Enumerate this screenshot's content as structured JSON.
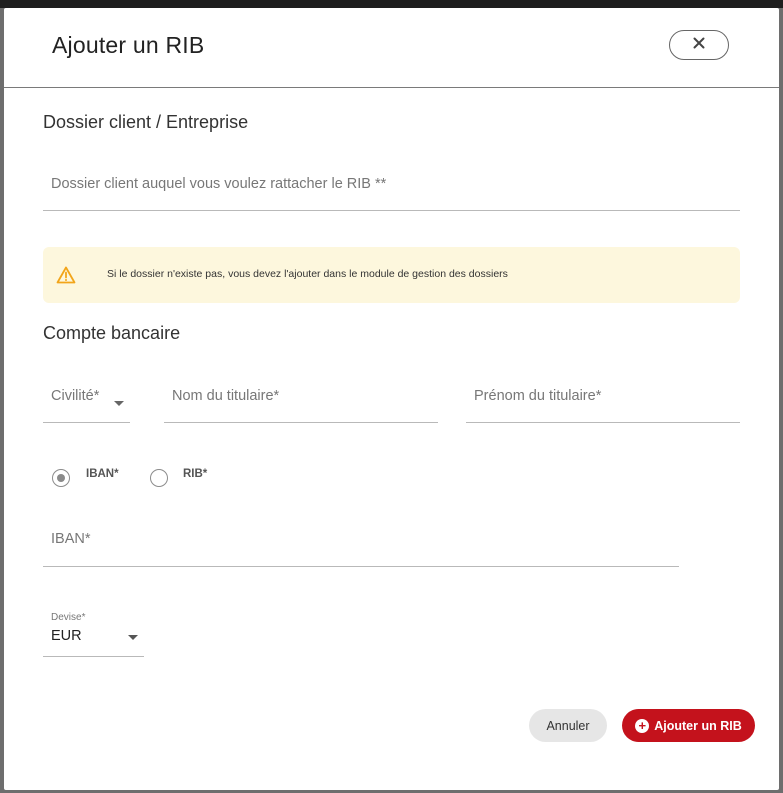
{
  "dialog": {
    "title": "Ajouter un RIB",
    "close_icon": "close-icon"
  },
  "dossier": {
    "section_title": "Dossier client / Entreprise",
    "client_placeholder": "Dossier client auquel vous voulez rattacher le RIB **"
  },
  "alert": {
    "icon": "warning-icon",
    "text": "Si le dossier n'existe pas, vous devez l'ajouter dans le module de gestion des dossiers"
  },
  "compte": {
    "section_title": "Compte bancaire",
    "civilite_label": "Civilité*",
    "nom_label": "Nom du titulaire*",
    "prenom_label": "Prénom du titulaire*",
    "radio_iban_label": "IBAN*",
    "radio_rib_label": "RIB*",
    "selected": "IBAN",
    "iban_placeholder": "IBAN*",
    "devise_label": "Devise*",
    "devise_value": "EUR"
  },
  "actions": {
    "cancel_label": "Annuler",
    "add_label": "Ajouter un RIB"
  },
  "colors": {
    "primary": "#c4121c",
    "alert_bg": "#fdf7dd",
    "warning": "#f2a51a"
  }
}
